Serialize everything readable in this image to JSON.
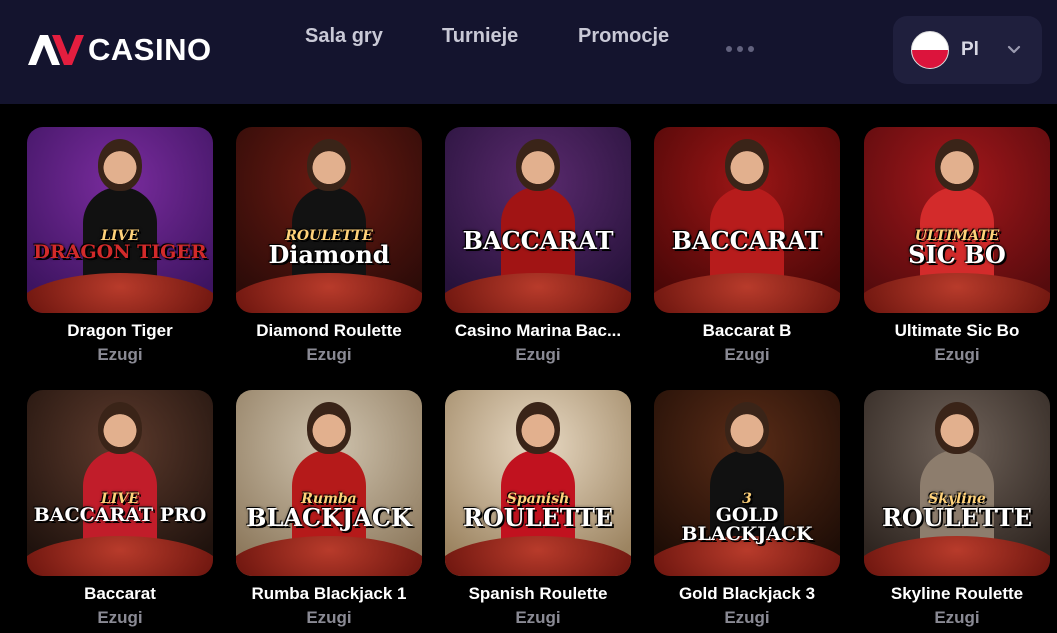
{
  "header": {
    "brand": "CASINO",
    "nav": [
      "Sala gry",
      "Turnieje",
      "Promocje"
    ],
    "language": {
      "code": "Pl",
      "flag": "poland-flag-icon"
    }
  },
  "games": [
    {
      "title": "Dragon Tiger",
      "provider": "Ezugi",
      "logo": "DRAGON TIGER",
      "sublogo": "LIVE",
      "bg": "#7a2c9e",
      "bg2": "#3d1460",
      "dress": "#111111",
      "logo_color": "#d22a2a"
    },
    {
      "title": "Diamond Roulette",
      "provider": "Ezugi",
      "logo": "Diamond",
      "sublogo": "ROULETTE",
      "bg": "#6b1a12",
      "bg2": "#2c0b08",
      "dress": "#121212",
      "logo_color": "#ffffff"
    },
    {
      "title": "Casino Marina Bac...",
      "provider": "Ezugi",
      "logo": "BACCARAT",
      "sublogo": "",
      "bg": "#5a2a6e",
      "bg2": "#26123a",
      "dress": "#a11414",
      "logo_color": "#ffffff"
    },
    {
      "title": "Baccarat B",
      "provider": "Ezugi",
      "logo": "BACCARAT",
      "sublogo": "",
      "bg": "#9c1616",
      "bg2": "#4a0707",
      "dress": "#b71c1c",
      "logo_color": "#ffffff"
    },
    {
      "title": "Ultimate Sic Bo",
      "provider": "Ezugi",
      "logo": "SIC BO",
      "sublogo": "ULTIMATE",
      "bg": "#a3171b",
      "bg2": "#560b0d",
      "dress": "#d32b2b",
      "logo_color": "#ffffff"
    },
    {
      "title": "Baccarat",
      "provider": "Ezugi",
      "logo": "BACCARAT PRO",
      "sublogo": "LIVE",
      "bg": "#5c3a2c",
      "bg2": "#1f120d",
      "dress": "#c11d2a",
      "logo_color": "#ffffff"
    },
    {
      "title": "Rumba Blackjack 1",
      "provider": "Ezugi",
      "logo": "BLACKJACK",
      "sublogo": "Rumba",
      "bg": "#cfc3ae",
      "bg2": "#8e7a5e",
      "dress": "#b51a1a",
      "logo_color": "#ffffff"
    },
    {
      "title": "Spanish Roulette",
      "provider": "Ezugi",
      "logo": "ROULETTE",
      "sublogo": "Spanish",
      "bg": "#e8d9c3",
      "bg2": "#9c8461",
      "dress": "#c1121f",
      "logo_color": "#ffffff"
    },
    {
      "title": "Gold Blackjack 3",
      "provider": "Ezugi",
      "logo": "GOLD BLACKJACK",
      "sublogo": "3",
      "bg": "#5a2c17",
      "bg2": "#1e0d06",
      "dress": "#111111",
      "logo_color": "#ffffff"
    },
    {
      "title": "Skyline Roulette",
      "provider": "Ezugi",
      "logo": "ROULETTE",
      "sublogo": "Skyline",
      "bg": "#6f6259",
      "bg2": "#2e2520",
      "dress": "#8d7d6d",
      "logo_color": "#ffffff"
    }
  ]
}
